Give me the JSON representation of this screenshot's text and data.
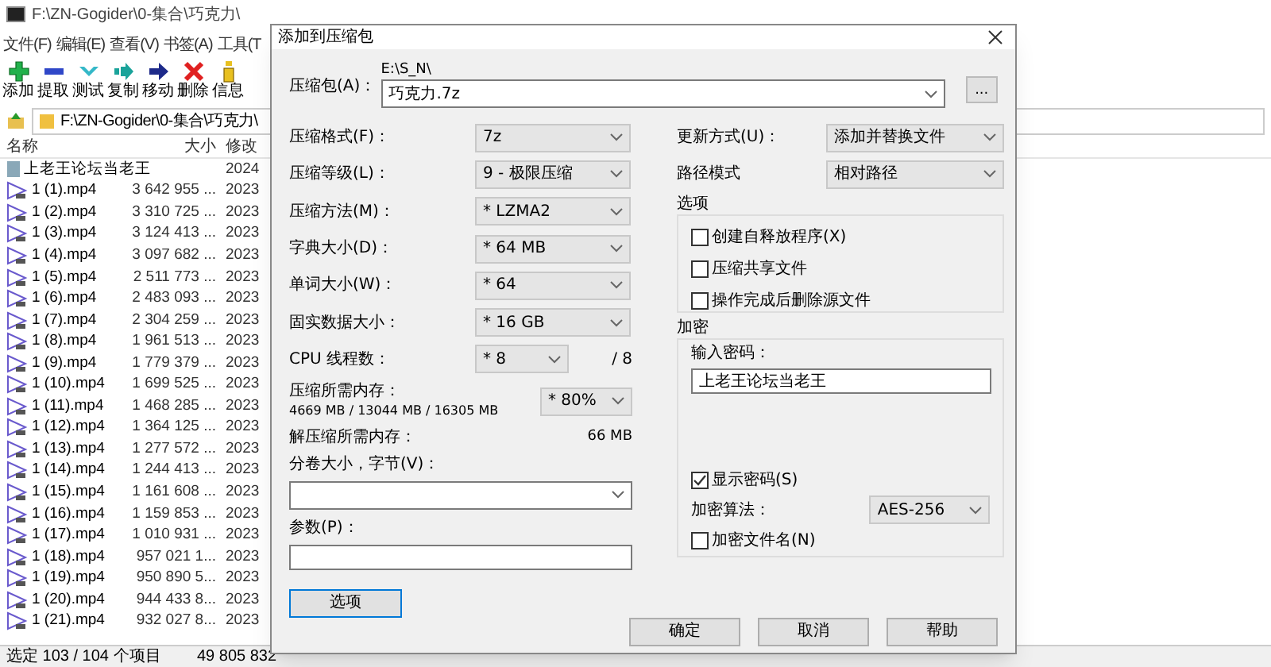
{
  "file_manager": {
    "title": "F:\\ZN-Gogider\\0-集合\\巧克力\\",
    "menu": [
      "文件(F)",
      "编辑(E)",
      "查看(V)",
      "书签(A)",
      "工具(T"
    ],
    "toolbar": [
      {
        "kind": "add",
        "label": "添加"
      },
      {
        "kind": "extract",
        "label": "提取"
      },
      {
        "kind": "test",
        "label": "测试"
      },
      {
        "kind": "copy",
        "label": "复制"
      },
      {
        "kind": "move",
        "label": "移动"
      },
      {
        "kind": "delete",
        "label": "删除"
      },
      {
        "kind": "info",
        "label": "信息"
      }
    ],
    "address": "F:\\ZN-Gogider\\0-集合\\巧克力\\",
    "columns": [
      "名称",
      "大小",
      "修改"
    ],
    "rows": [
      {
        "kind": "folder",
        "name": "上老王论坛当老王",
        "size": "",
        "date": "2024"
      },
      {
        "kind": "video",
        "name": "1 (1).mp4",
        "size": "3 642 955 ...",
        "date": "2023"
      },
      {
        "kind": "video",
        "name": "1 (2).mp4",
        "size": "3 310 725 ...",
        "date": "2023"
      },
      {
        "kind": "video",
        "name": "1 (3).mp4",
        "size": "3 124 413 ...",
        "date": "2023"
      },
      {
        "kind": "video",
        "name": "1 (4).mp4",
        "size": "3 097 682 ...",
        "date": "2023"
      },
      {
        "kind": "video",
        "name": "1 (5).mp4",
        "size": "2 511 773 ...",
        "date": "2023"
      },
      {
        "kind": "video",
        "name": "1 (6).mp4",
        "size": "2 483 093 ...",
        "date": "2023"
      },
      {
        "kind": "video",
        "name": "1 (7).mp4",
        "size": "2 304 259 ...",
        "date": "2023"
      },
      {
        "kind": "video",
        "name": "1 (8).mp4",
        "size": "1 961 513 ...",
        "date": "2023"
      },
      {
        "kind": "video",
        "name": "1 (9).mp4",
        "size": "1 779 379 ...",
        "date": "2023"
      },
      {
        "kind": "video",
        "name": "1 (10).mp4",
        "size": "1 699 525 ...",
        "date": "2023"
      },
      {
        "kind": "video",
        "name": "1 (11).mp4",
        "size": "1 468 285 ...",
        "date": "2023"
      },
      {
        "kind": "video",
        "name": "1 (12).mp4",
        "size": "1 364 125 ...",
        "date": "2023"
      },
      {
        "kind": "video",
        "name": "1 (13).mp4",
        "size": "1 277 572 ...",
        "date": "2023"
      },
      {
        "kind": "video",
        "name": "1 (14).mp4",
        "size": "1 244 413 ...",
        "date": "2023"
      },
      {
        "kind": "video",
        "name": "1 (15).mp4",
        "size": "1 161 608 ...",
        "date": "2023"
      },
      {
        "kind": "video",
        "name": "1 (16).mp4",
        "size": "1 159 853 ...",
        "date": "2023"
      },
      {
        "kind": "video",
        "name": "1 (17).mp4",
        "size": "1 010 931 ...",
        "date": "2023"
      },
      {
        "kind": "video",
        "name": "1 (18).mp4",
        "size": "957 021 1...",
        "date": "2023"
      },
      {
        "kind": "video",
        "name": "1 (19).mp4",
        "size": "950 890 5...",
        "date": "2023"
      },
      {
        "kind": "video",
        "name": "1 (20).mp4",
        "size": "944 433 8...",
        "date": "2023"
      },
      {
        "kind": "video",
        "name": "1 (21).mp4",
        "size": "932 027 8...",
        "date": "2023"
      }
    ],
    "status": [
      "选定 103 / 104 个项目",
      "49 805 832"
    ]
  },
  "dialog": {
    "title": "添加到压缩包",
    "archive": {
      "label": "压缩包(A)：",
      "path": "E:\\S_N\\",
      "value": "巧克力.7z",
      "browse": "..."
    },
    "fields": [
      {
        "label": "压缩格式(F)：",
        "value": "7z"
      },
      {
        "label": "压缩等级(L)：",
        "value": "9 - 极限压缩"
      },
      {
        "label": "压缩方法(M)：",
        "value": "* LZMA2"
      },
      {
        "label": "字典大小(D)：",
        "value": "* 64 MB"
      },
      {
        "label": "单词大小(W)：",
        "value": "* 64"
      },
      {
        "label": "固实数据大小：",
        "value": "* 16 GB"
      }
    ],
    "cpu": {
      "label": "CPU 线程数：",
      "value": "* 8",
      "suffix": "/ 8"
    },
    "memory": {
      "label": "压缩所需内存：",
      "detail": "4669 MB / 13044 MB / 16305 MB",
      "value": "* 80%"
    },
    "decompress": {
      "label": "解压缩所需内存：",
      "value": "66 MB"
    },
    "volume": {
      "label": "分卷大小，字节(V)："
    },
    "params": {
      "label": "参数(P)："
    },
    "options_button": "选项",
    "update": {
      "label": "更新方式(U)：",
      "value": "添加并替换文件"
    },
    "path_mode": {
      "label": "路径模式",
      "value": "相对路径"
    },
    "options_group": {
      "title": "选项",
      "items": [
        {
          "label": "创建自释放程序(X)",
          "checked": false
        },
        {
          "label": "压缩共享文件",
          "checked": false
        },
        {
          "label": "操作完成后删除源文件",
          "checked": false
        }
      ]
    },
    "encryption": {
      "title": "加密",
      "password_label": "输入密码：",
      "password": "上老王论坛当老王",
      "show_password": {
        "label": "显示密码(S)",
        "checked": true
      },
      "method": {
        "label": "加密算法：",
        "value": "AES-256"
      },
      "encrypt_names": {
        "label": "加密文件名(N)",
        "checked": false
      }
    },
    "buttons": [
      "确定",
      "取消",
      "帮助"
    ]
  }
}
